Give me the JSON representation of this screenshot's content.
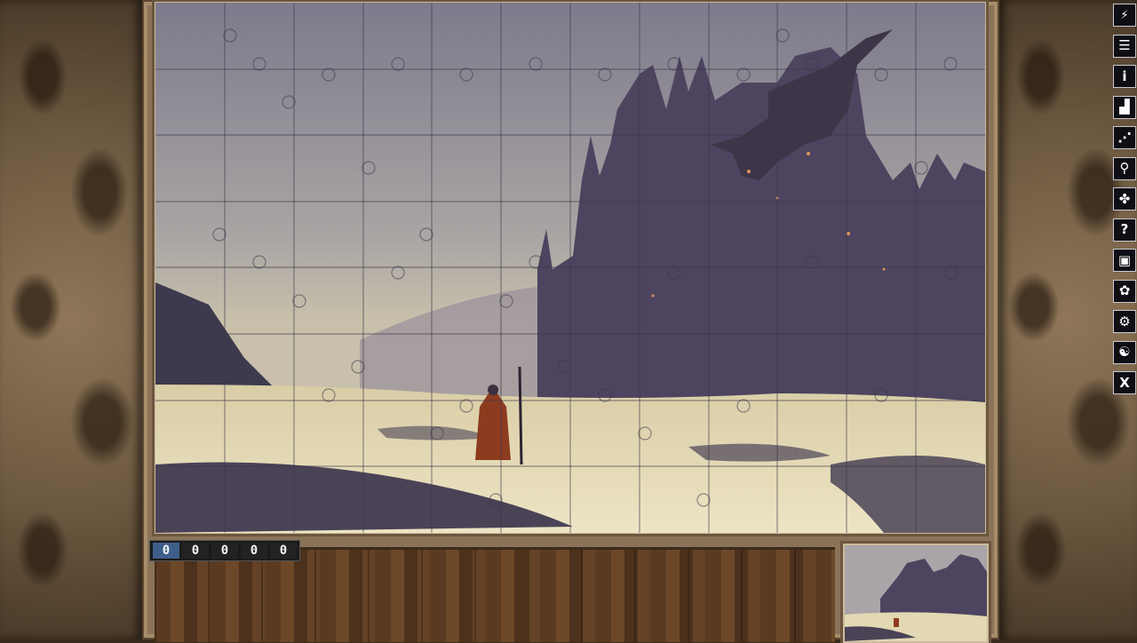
{
  "counter": {
    "digits": [
      "0",
      "0",
      "0",
      "0",
      "0"
    ]
  },
  "toolbar": {
    "icons": [
      "shuffle-pieces-icon",
      "menu-list-icon",
      "info-icon",
      "edge-pieces-icon",
      "sort-pieces-icon",
      "zoom-icon",
      "piece-icon",
      "hint-icon",
      "preview-icon",
      "background-icon",
      "settings-icon",
      "ghost-icon",
      "close-icon"
    ]
  },
  "puzzle": {
    "columns": 12,
    "rows": 8,
    "sky_color": "#8a8896",
    "castle_color": "#4a4358",
    "sea_light_color": "#e6dcb6"
  }
}
